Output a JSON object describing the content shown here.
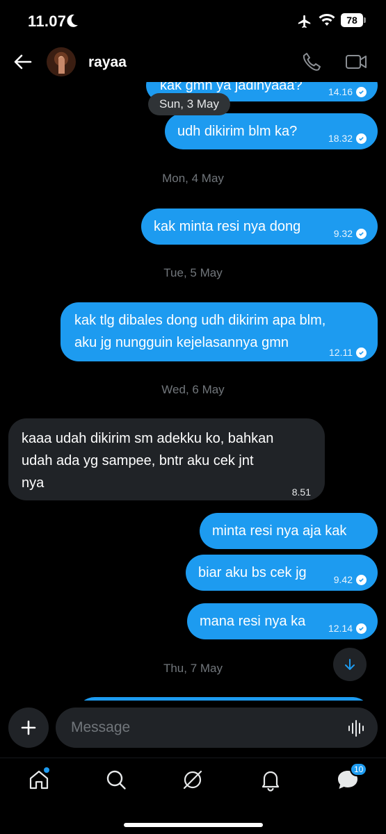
{
  "status_bar": {
    "time": "11.07",
    "battery": "78"
  },
  "header": {
    "contact_name": "rayaa"
  },
  "messages": [
    {
      "direction": "out",
      "text": "kak gmn ya jadinyaaa?",
      "time": "14.16"
    },
    {
      "direction": "out",
      "text": "udh dikirim blm ka?",
      "time": "18.32"
    },
    {
      "direction": "out",
      "text": "kak minta resi nya dong",
      "time": "9.32"
    },
    {
      "direction": "out",
      "text_line1": "kak tlg dibales dong udh dikirim apa blm,",
      "text_line2": "aku jg nungguin kejelasannya gmn",
      "time": "12.11"
    },
    {
      "direction": "in",
      "text_line1": "kaaa udah dikirim sm adekku ko, bahkan",
      "text_line2": "udah ada yg sampee, bntr aku cek jnt",
      "text_line3": "nya",
      "time": "8.51"
    },
    {
      "direction": "out",
      "text": "minta resi nya aja kak"
    },
    {
      "direction": "out",
      "text": "biar aku bs cek jg",
      "time": "9.42"
    },
    {
      "direction": "out",
      "text": "mana resi nya ka",
      "time": "12.14"
    }
  ],
  "date_separators": {
    "sticky": "Sun, 3 May",
    "mon": "Mon, 4 May",
    "tue": "Tue, 5 May",
    "wed": "Wed, 6 May",
    "thu": "Thu, 7 May"
  },
  "composer": {
    "placeholder": "Message"
  },
  "nav": {
    "messages_badge": "10"
  },
  "colors": {
    "accent": "#1d9bf0",
    "incoming_bubble": "#202327",
    "background": "#000000",
    "muted_text": "#71767b"
  },
  "icons": [
    "back-arrow-icon",
    "phone-icon",
    "video-camera-icon",
    "plus-icon",
    "voice-wave-icon",
    "arrow-down-icon",
    "home-icon",
    "search-icon",
    "grok-icon",
    "bell-icon",
    "messages-icon",
    "read-check-icon",
    "moon-icon",
    "airplane-icon",
    "wifi-icon"
  ]
}
